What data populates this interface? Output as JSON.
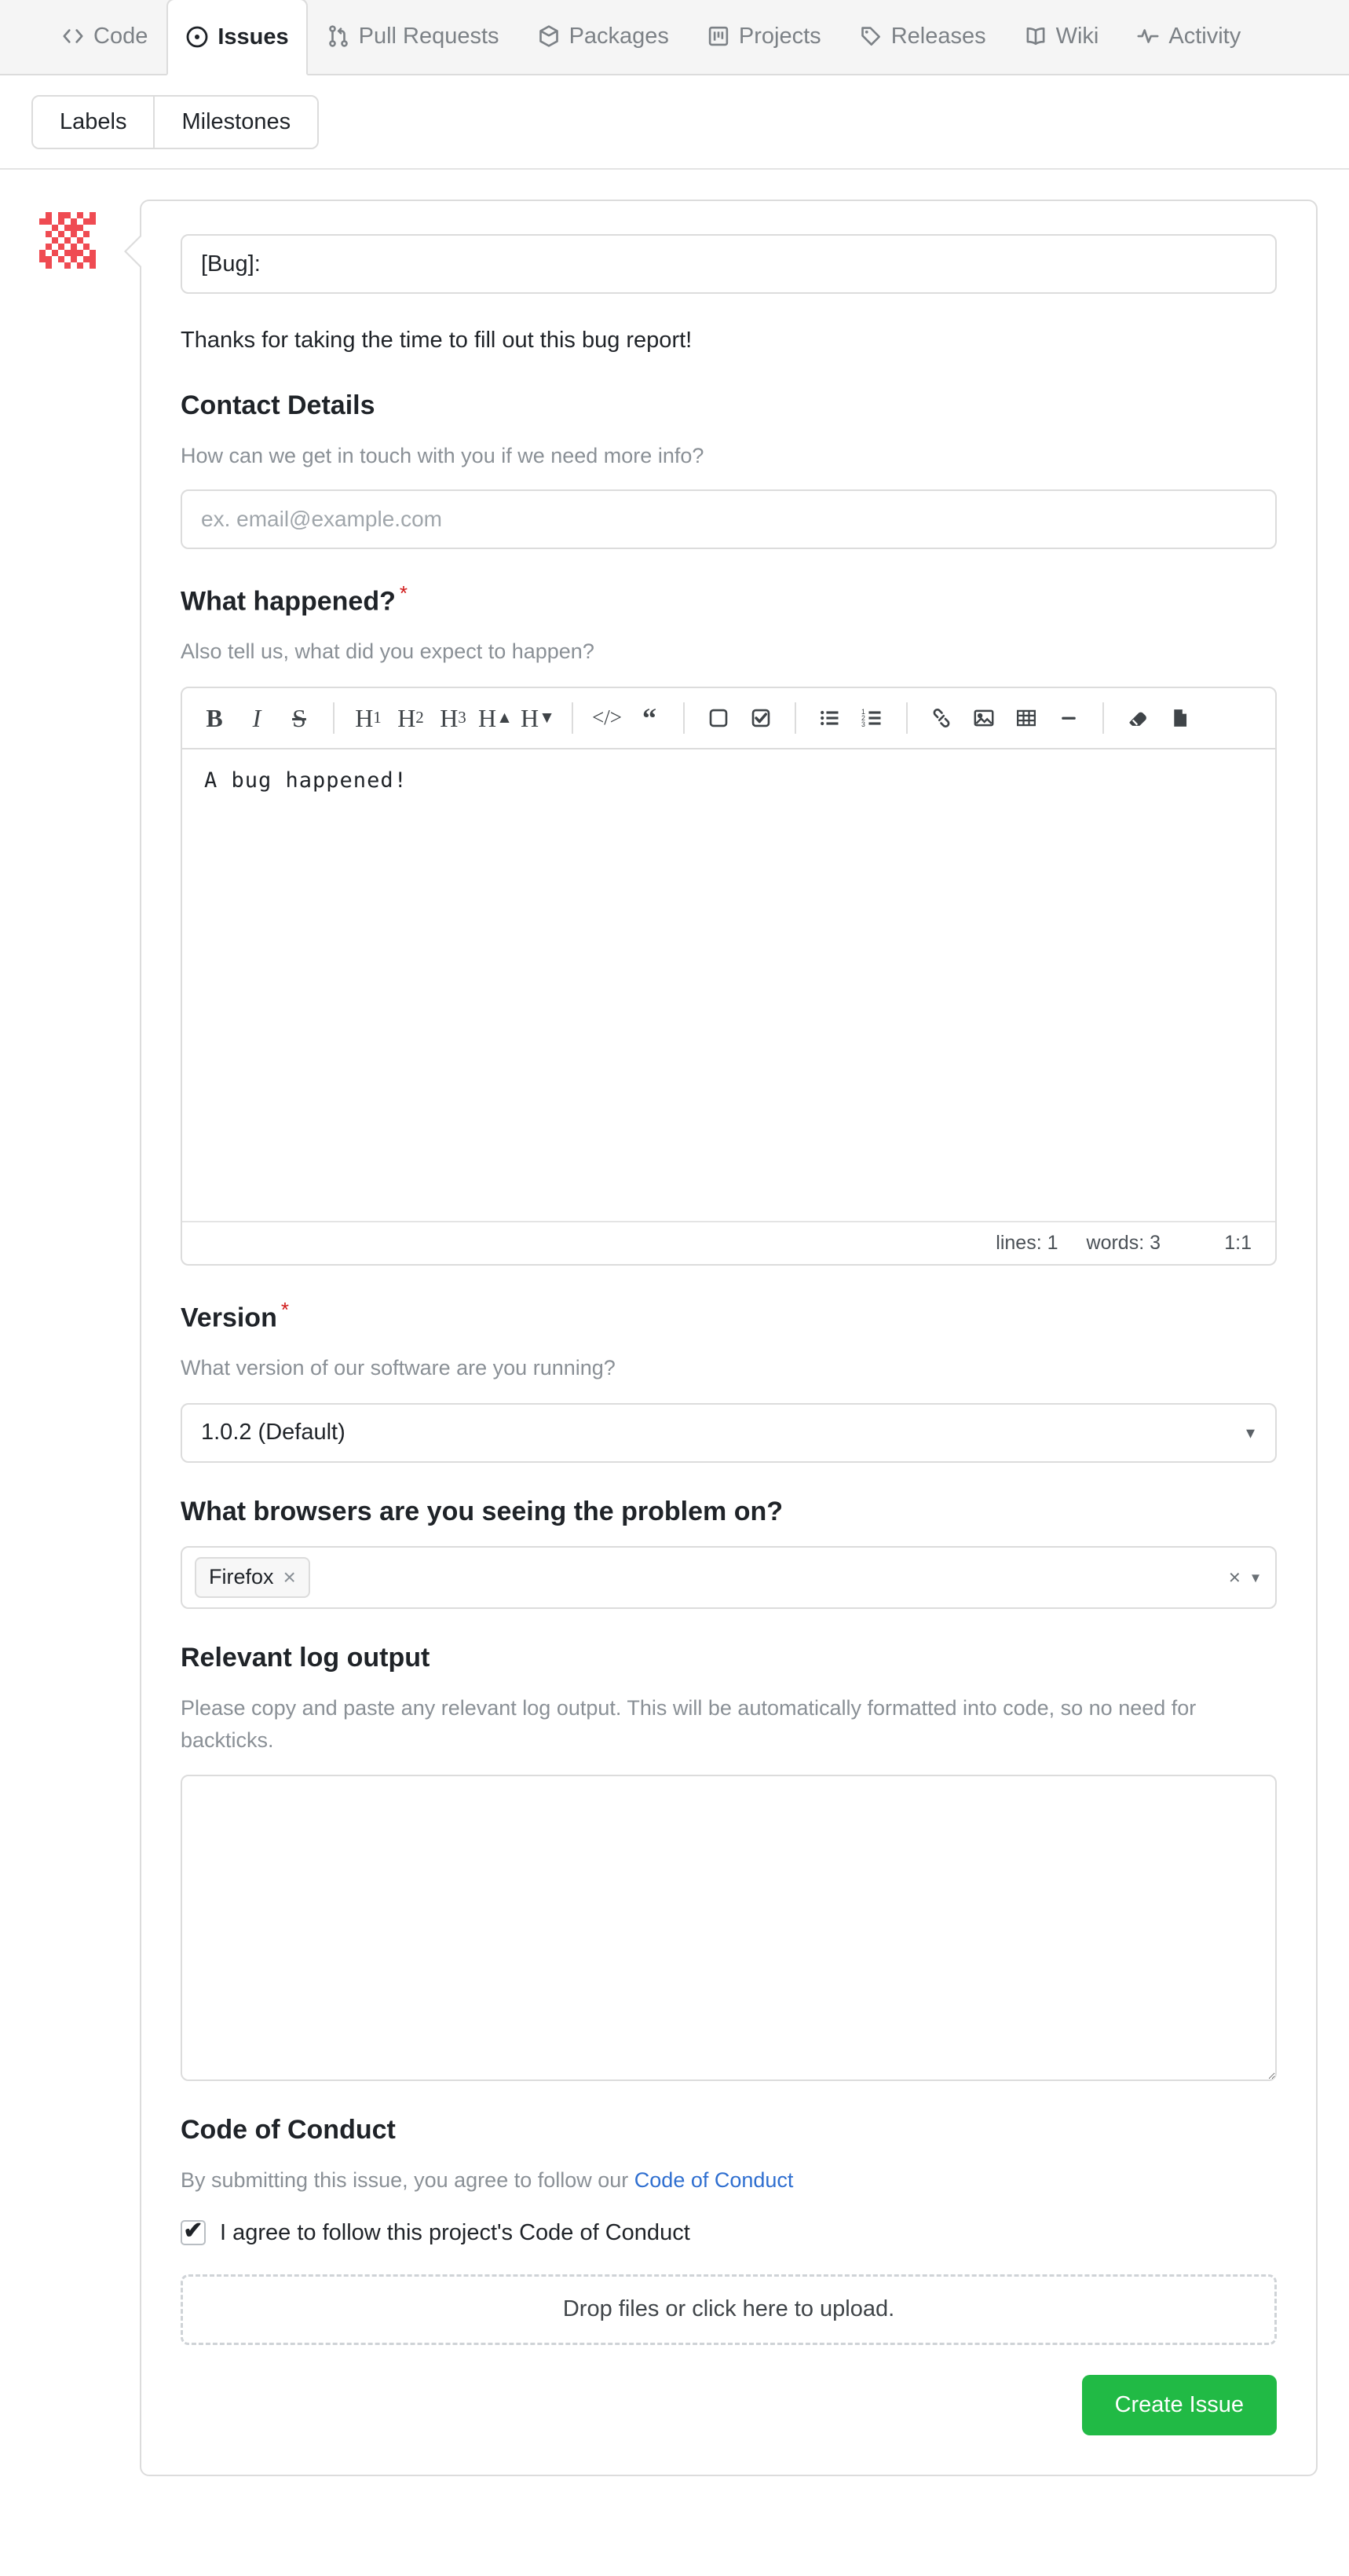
{
  "repo_nav": {
    "tabs": [
      {
        "label": "Code",
        "icon": "code-icon",
        "active": false
      },
      {
        "label": "Issues",
        "icon": "issue-opened-icon",
        "active": true
      },
      {
        "label": "Pull Requests",
        "icon": "git-pull-request-icon",
        "active": false
      },
      {
        "label": "Packages",
        "icon": "package-icon",
        "active": false
      },
      {
        "label": "Projects",
        "icon": "project-icon",
        "active": false
      },
      {
        "label": "Releases",
        "icon": "tag-icon",
        "active": false
      },
      {
        "label": "Wiki",
        "icon": "book-icon",
        "active": false
      },
      {
        "label": "Activity",
        "icon": "pulse-icon",
        "active": false
      }
    ]
  },
  "subbar": {
    "labels_button": "Labels",
    "milestones_button": "Milestones"
  },
  "form": {
    "title_value": "[Bug]:",
    "intro": "Thanks for taking the time to fill out this bug report!",
    "contact": {
      "heading": "Contact Details",
      "description": "How can we get in touch with you if we need more info?",
      "placeholder": "ex. email@example.com",
      "value": ""
    },
    "what_happened": {
      "heading": "What happened?",
      "required_mark": "*",
      "description": "Also tell us, what did you expect to happen?",
      "body_value": "A bug happened!",
      "status": {
        "lines": "lines: 1",
        "words": "words: 3",
        "position": "1:1"
      },
      "toolbar": [
        {
          "name": "bold-icon",
          "glyph": "B"
        },
        {
          "name": "italic-icon",
          "glyph": "I"
        },
        {
          "name": "strikethrough-icon",
          "glyph": "S"
        },
        {
          "name": "separator",
          "glyph": ""
        },
        {
          "name": "heading-1-icon",
          "glyph": "H1"
        },
        {
          "name": "heading-2-icon",
          "glyph": "H2"
        },
        {
          "name": "heading-3-icon",
          "glyph": "H3"
        },
        {
          "name": "heading-increase-icon",
          "glyph": "H▲"
        },
        {
          "name": "heading-decrease-icon",
          "glyph": "H▼"
        },
        {
          "name": "separator",
          "glyph": ""
        },
        {
          "name": "code-icon",
          "glyph": "</>"
        },
        {
          "name": "quote-icon",
          "glyph": "❝"
        },
        {
          "name": "separator",
          "glyph": ""
        },
        {
          "name": "checkbox-unchecked-icon",
          "glyph": "☐"
        },
        {
          "name": "checkbox-checked-icon",
          "glyph": "☑"
        },
        {
          "name": "separator",
          "glyph": ""
        },
        {
          "name": "bulleted-list-icon",
          "glyph": "☰"
        },
        {
          "name": "numbered-list-icon",
          "glyph": "≡"
        },
        {
          "name": "separator",
          "glyph": ""
        },
        {
          "name": "link-icon",
          "glyph": "🔗"
        },
        {
          "name": "image-icon",
          "glyph": "🖼"
        },
        {
          "name": "table-icon",
          "glyph": "▦"
        },
        {
          "name": "horizontal-rule-icon",
          "glyph": "—"
        },
        {
          "name": "separator",
          "glyph": ""
        },
        {
          "name": "eraser-icon",
          "glyph": "🧽"
        },
        {
          "name": "file-icon",
          "glyph": "📄"
        }
      ]
    },
    "version": {
      "heading": "Version",
      "required_mark": "*",
      "description": "What version of our software are you running?",
      "selected": "1.0.2 (Default)"
    },
    "browsers": {
      "heading": "What browsers are you seeing the problem on?",
      "chips": [
        "Firefox"
      ],
      "chip_remove": "×",
      "clear_all": "×",
      "caret": "▾"
    },
    "log_output": {
      "heading": "Relevant log output",
      "description": "Please copy and paste any relevant log output. This will be automatically formatted into code, so no need for backticks.",
      "value": ""
    },
    "code_of_conduct": {
      "heading": "Code of Conduct",
      "description_prefix": "By submitting this issue, you agree to follow our ",
      "link_text": "Code of Conduct",
      "checkbox_label": "I agree to follow this project's Code of Conduct",
      "checked": true,
      "tick_glyph": "✔"
    },
    "dropzone_text": "Drop files or click here to upload.",
    "submit_label": "Create Issue"
  },
  "colors": {
    "accent_green": "#21ba45",
    "required_red": "#d01919",
    "link_blue": "#2f6fd0",
    "avatar_red": "#ef4b52",
    "border": "#dcdcdc",
    "muted_text": "#8a9096"
  }
}
